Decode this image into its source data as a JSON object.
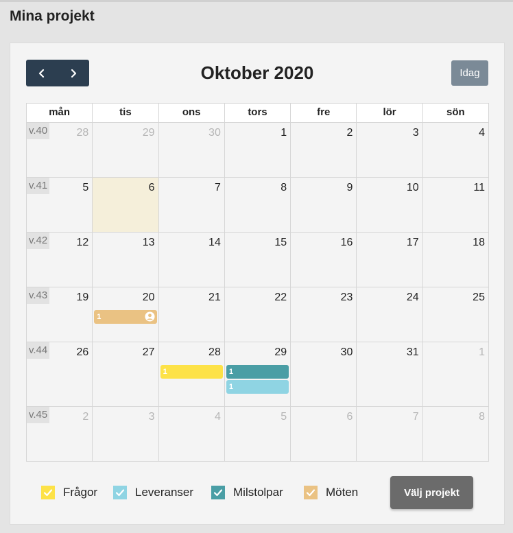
{
  "page": {
    "title": "Mina projekt"
  },
  "toolbar": {
    "month_title": "Oktober 2020",
    "today_label": "Idag",
    "prev_icon": "chevron-left-icon",
    "next_icon": "chevron-right-icon"
  },
  "weekdays": [
    "mån",
    "tis",
    "ons",
    "tors",
    "fre",
    "lör",
    "sön"
  ],
  "weeks": [
    {
      "label": "v.40",
      "days": [
        {
          "n": "28",
          "other": true
        },
        {
          "n": "29",
          "other": true
        },
        {
          "n": "30",
          "other": true
        },
        {
          "n": "1"
        },
        {
          "n": "2"
        },
        {
          "n": "3"
        },
        {
          "n": "4"
        }
      ]
    },
    {
      "label": "v.41",
      "days": [
        {
          "n": "5"
        },
        {
          "n": "6",
          "today": true
        },
        {
          "n": "7"
        },
        {
          "n": "8"
        },
        {
          "n": "9"
        },
        {
          "n": "10"
        },
        {
          "n": "11"
        }
      ]
    },
    {
      "label": "v.42",
      "days": [
        {
          "n": "12"
        },
        {
          "n": "13"
        },
        {
          "n": "14"
        },
        {
          "n": "15"
        },
        {
          "n": "16"
        },
        {
          "n": "17"
        },
        {
          "n": "18"
        }
      ]
    },
    {
      "label": "v.43",
      "days": [
        {
          "n": "19"
        },
        {
          "n": "20",
          "events": [
            {
              "label": "1",
              "category": "moten",
              "icon": "user-circle-icon"
            }
          ]
        },
        {
          "n": "21"
        },
        {
          "n": "22"
        },
        {
          "n": "23"
        },
        {
          "n": "24"
        },
        {
          "n": "25"
        }
      ]
    },
    {
      "label": "v.44",
      "days": [
        {
          "n": "26"
        },
        {
          "n": "27"
        },
        {
          "n": "28",
          "events": [
            {
              "label": "1",
              "category": "fragor"
            }
          ]
        },
        {
          "n": "29",
          "events": [
            {
              "label": "1",
              "category": "milstolpar"
            },
            {
              "label": "1",
              "category": "leveranser"
            }
          ]
        },
        {
          "n": "30"
        },
        {
          "n": "31"
        },
        {
          "n": "1",
          "other": true
        }
      ]
    },
    {
      "label": "v.45",
      "days": [
        {
          "n": "2",
          "other": true
        },
        {
          "n": "3",
          "other": true
        },
        {
          "n": "4",
          "other": true
        },
        {
          "n": "5",
          "other": true
        },
        {
          "n": "6",
          "other": true
        },
        {
          "n": "7",
          "other": true
        },
        {
          "n": "8",
          "other": true
        }
      ]
    }
  ],
  "categories": {
    "fragor": "#fde247",
    "leveranser": "#8fd4e3",
    "milstolpar": "#4a9ea5",
    "moten": "#eac283"
  },
  "legend": [
    {
      "label": "Frågor",
      "color": "#fde247",
      "checked": true
    },
    {
      "label": "Leveranser",
      "color": "#8fd4e3",
      "checked": true
    },
    {
      "label": "Milstolpar",
      "color": "#4a9ea5",
      "checked": true
    },
    {
      "label": "Möten",
      "color": "#eac283",
      "checked": true
    }
  ],
  "select_project_label": "Välj projekt",
  "colors": {
    "nav_bg": "#2c3e50",
    "today_bg": "#f5efda",
    "today_button": "#7b8a97"
  }
}
